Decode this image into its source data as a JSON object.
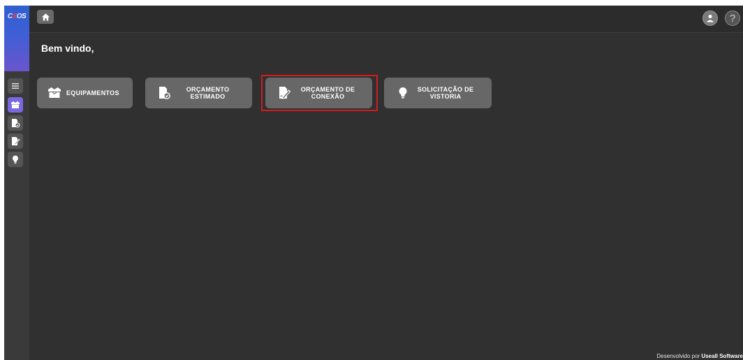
{
  "app": {
    "logo_text": "CXOS"
  },
  "header": {
    "home_icon": "home-icon",
    "user_icon": "user-account-icon",
    "help_label": "?"
  },
  "sidebar": {
    "items": [
      {
        "name": "menu",
        "icon": "hamburger-menu-icon",
        "active": false
      },
      {
        "name": "equipamentos",
        "icon": "boxes-icon",
        "active": true
      },
      {
        "name": "orcamento-estimado",
        "icon": "document-check-icon",
        "active": false
      },
      {
        "name": "orcamento-conexao",
        "icon": "document-edit-icon",
        "active": false
      },
      {
        "name": "solicitacao-vistoria",
        "icon": "lightbulb-icon",
        "active": false
      }
    ]
  },
  "main": {
    "welcome": "Bem vindo,",
    "cards": [
      {
        "label": "EQUIPAMENTOS",
        "icon": "boxes-icon"
      },
      {
        "label": "ORÇAMENTO\nESTIMADO",
        "icon": "document-check-icon"
      },
      {
        "label": "ORÇAMENTO DE\nCONEXÃO",
        "icon": "document-edit-icon"
      },
      {
        "label": "SOLICITAÇÃO DE\nVISTORIA",
        "icon": "lightbulb-icon"
      }
    ]
  },
  "footer": {
    "prefix": "Desenvolvido por ",
    "company": "Useall Software"
  },
  "colors": {
    "background": "#303030",
    "card": "#676767",
    "accent": "#7a68e0",
    "highlight": "#d01c1c"
  }
}
